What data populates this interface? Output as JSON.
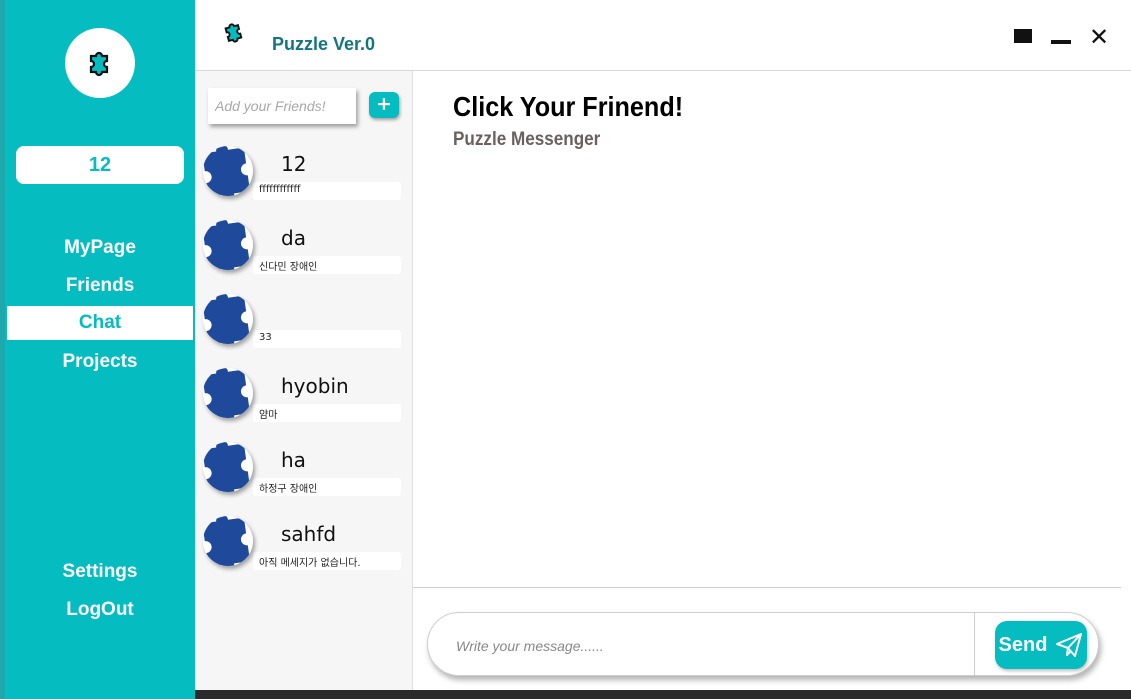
{
  "app": {
    "title": "Puzzle Ver.0",
    "colors": {
      "accent": "#05bcc0",
      "avatar_blue": "#1f4a9c",
      "title_teal": "#12777b"
    }
  },
  "sidebar": {
    "user_number": "12",
    "nav": [
      {
        "label": "MyPage"
      },
      {
        "label": "Friends"
      },
      {
        "label": "Chat",
        "active": true
      },
      {
        "label": "Projects"
      }
    ],
    "settings_label": "Settings",
    "logout_label": "LogOut"
  },
  "friends_panel": {
    "add_placeholder": "Add your Friends!",
    "add_button_label": "+",
    "friends": [
      {
        "name": "12",
        "last_message": "ffffffffffff"
      },
      {
        "name": "da",
        "last_message": "신다민 장애인"
      },
      {
        "name": "",
        "last_message": "33"
      },
      {
        "name": "hyobin",
        "last_message": "얌마"
      },
      {
        "name": "ha",
        "last_message": "하정구 장애인"
      },
      {
        "name": "sahfd",
        "last_message": "아직 메세지가 없습니다."
      }
    ]
  },
  "chat": {
    "title": "Click Your Frinend!",
    "subtitle": "Puzzle Messenger",
    "input_placeholder": "Write your message......",
    "send_label": "Send"
  },
  "window_controls": {
    "icons": [
      "maximize-icon",
      "minimize-icon",
      "close-icon"
    ],
    "close_glyph": "✕"
  }
}
